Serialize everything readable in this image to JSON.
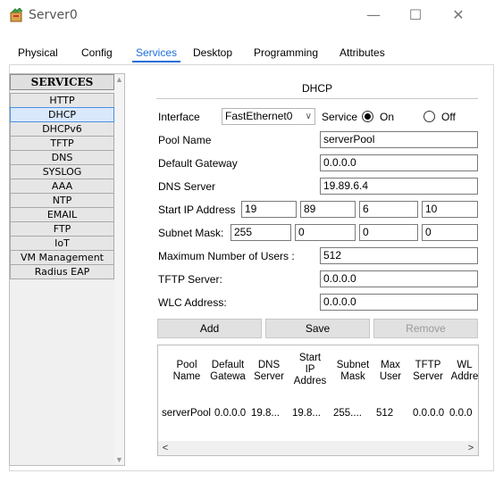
{
  "window": {
    "title": "Server0",
    "minimize": "—",
    "maximize": "☐",
    "close": "✕"
  },
  "tabs": [
    {
      "label": "Physical"
    },
    {
      "label": "Config"
    },
    {
      "label": "Services",
      "active": true
    },
    {
      "label": "Desktop"
    },
    {
      "label": "Programming"
    },
    {
      "label": "Attributes"
    }
  ],
  "services": {
    "header": "SERVICES",
    "items": [
      "HTTP",
      "DHCP",
      "DHCPv6",
      "TFTP",
      "DNS",
      "SYSLOG",
      "AAA",
      "NTP",
      "EMAIL",
      "FTP",
      "IoT",
      "VM Management",
      "Radius EAP"
    ],
    "selected": "DHCP"
  },
  "dhcp": {
    "title": "DHCP",
    "interface_label": "Interface",
    "interface_value": "FastEthernet0",
    "service_label": "Service",
    "on_label": "On",
    "off_label": "Off",
    "service_state": "On",
    "pool_name_label": "Pool Name",
    "pool_name": "serverPool",
    "gateway_label": "Default Gateway",
    "gateway": "0.0.0.0",
    "dns_label": "DNS Server",
    "dns": "19.89.6.4",
    "start_ip_label": "Start IP Address",
    "start_ip": [
      "19",
      "89",
      "6",
      "10"
    ],
    "subnet_label": "Subnet Mask:",
    "subnet": [
      "255",
      "0",
      "0",
      "0"
    ],
    "max_users_label": "Maximum Number of Users :",
    "max_users": "512",
    "tftp_label": "TFTP Server:",
    "tftp": "0.0.0.0",
    "wlc_label": "WLC Address:",
    "wlc": "0.0.0.0",
    "buttons": {
      "add": "Add",
      "save": "Save",
      "remove": "Remove"
    }
  },
  "pool_table": {
    "headers": [
      [
        "Pool",
        "Name"
      ],
      [
        "Default",
        "Gatewa"
      ],
      [
        "DNS",
        "Server"
      ],
      [
        "Start",
        "IP",
        "Addres"
      ],
      [
        "Subnet",
        "Mask"
      ],
      [
        "Max",
        "User"
      ],
      [
        "TFTP",
        "Server"
      ],
      [
        "WL",
        "Addre"
      ]
    ],
    "rows": [
      [
        "serverPool",
        "0.0.0.0",
        "19.8...",
        "19.8...",
        "255....",
        "512",
        "0.0.0.0",
        "0.0.0"
      ]
    ]
  },
  "colors": {
    "accent": "#1e6fd9",
    "selected_bg": "#d9e8fb",
    "selected_border": "#4a8fe7"
  }
}
